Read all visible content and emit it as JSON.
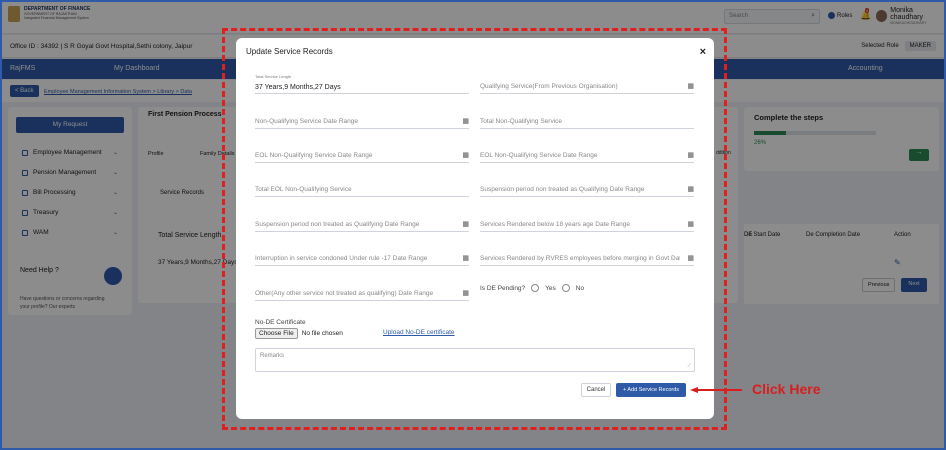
{
  "header": {
    "dept": "DEPARTMENT OF FINANCE",
    "dept_sub": "GOVERNMENT OF RAJASTHAN",
    "system": "Integrated Financial Management System",
    "search_placeholder": "Search",
    "roles": "Roles",
    "notifications": "8",
    "user_name": "Monika chaudhary",
    "user_role": "MONIKACHOUDHARY"
  },
  "office": {
    "text": "Office ID : 34392  |  S R Goyal Govt Hospital,Sethi colony, Jaipur",
    "selected_role_label": "Selected Role",
    "selected_role": "MAKER"
  },
  "nav": {
    "brand": "RajFMS",
    "dashboard": "My Dashboard",
    "accounting": "Accounting"
  },
  "crumb": {
    "back": "< Back",
    "path": "Employee Management Information System  >  Library  >  Data"
  },
  "sidebar": {
    "request": "My Request",
    "items": [
      "Employee Management",
      "Pension Management",
      "Bill Processing",
      "Treasury",
      "WAM"
    ],
    "help_title": "Need Help ?",
    "help_text": "Have questions or concerns regarding your profile? Our experts"
  },
  "bg": {
    "process_title": "First Pension Process",
    "step1": "Profile",
    "step2": "Family Details",
    "tab": "Service Records",
    "col_total": "Total Service Length",
    "row_total": "37 Years,9 Months,27 Days",
    "steps_title": "Complete the steps",
    "steps_pct": "26%",
    "col_de": "DE",
    "col_de_start": "De Start Date",
    "col_de_complete": "De Completion Date",
    "col_action": "Action",
    "prev": "Previous",
    "next": "Next",
    "addition": "ddition"
  },
  "progress": 0.26,
  "modal": {
    "title": "Update Service Records",
    "close": "×",
    "total_small": "Total Service Length",
    "total_value": "37 Years,9 Months,27 Days",
    "fields": [
      "Qualifying Service(From Previous Organisation)",
      "Non-Qualifying Service Date Range",
      "Total Non-Qualifying Service",
      "EOL Non-Qualifying Service Date Range",
      "EOL Non-Qualifying Service Date Range",
      "Total EOL Non-Qualifying Service",
      "Suspension period non treated as Qualifying Date Range",
      "Suspension period non treated as Qualifying Date Range",
      "Services Rendered below 18 years age Date Range",
      "Interruption in service condoned Under rule -17 Date Range",
      "Services Rendered by RVRES employees before merging in Govt Dat...",
      "Other(Any other service not treated as qualifying) Date Range"
    ],
    "de_pending": "Is DE Pending?",
    "yes": "Yes",
    "no": "No",
    "no_de_label": "No-DE Certificate",
    "choose_file": "Choose File",
    "no_file": "No file chosen",
    "upload_link": "Upload No-DE certificate",
    "remarks_placeholder": "Remarks",
    "cancel": "Cancel",
    "add": "+ Add Service Records"
  },
  "callout": "Click Here"
}
